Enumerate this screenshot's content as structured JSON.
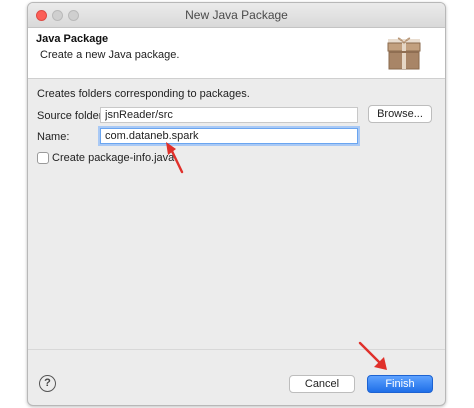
{
  "window": {
    "title": "New Java Package"
  },
  "banner": {
    "title": "Java Package",
    "message": "Create a new Java package.",
    "icon": "package-icon"
  },
  "form": {
    "description": "Creates folders corresponding to packages.",
    "source_folder": {
      "label": "Source folder:",
      "value": "jsnReader/src"
    },
    "browse_label": "Browse...",
    "name": {
      "label": "Name:",
      "value": "com.dataneb.spark"
    },
    "create_info": {
      "label": "Create package-info.java",
      "checked": false
    }
  },
  "footer": {
    "help_glyph": "?",
    "cancel_label": "Cancel",
    "finish_label": "Finish"
  },
  "annotations": {
    "arrow_color": "#e0302a"
  }
}
